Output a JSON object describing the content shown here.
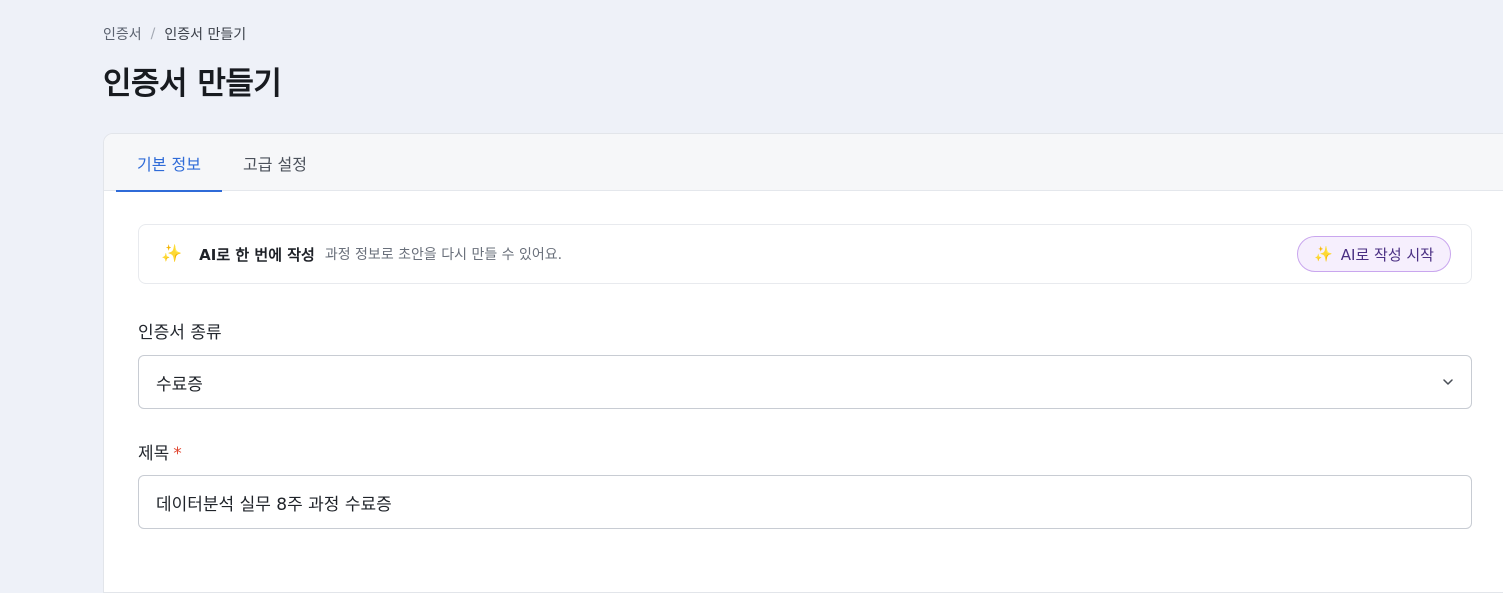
{
  "breadcrumb": {
    "items": [
      "인증서",
      "인증서 만들기"
    ],
    "separator": "/"
  },
  "page": {
    "title": "인증서 만들기"
  },
  "tabs": [
    {
      "label": "기본 정보",
      "active": true
    },
    {
      "label": "고급 설정",
      "active": false
    }
  ],
  "ai_banner": {
    "icon": "sparkle-icon",
    "title": "AI로 한 번에 작성",
    "description": "과정 정보로 초안을 다시 만들 수 있어요.",
    "button_label": "AI로 작성 시작"
  },
  "form": {
    "type_label": "인증서 종류",
    "type_value": "수료증",
    "title_label": "제목",
    "title_required_mark": "*",
    "title_value": "데이터분석 실무 8주 과정 수료증"
  },
  "colors": {
    "accent": "#2f6bd8",
    "ai_button_bg": "#f6effd",
    "ai_button_border": "#c9a6ee",
    "required": "#e0452f"
  }
}
